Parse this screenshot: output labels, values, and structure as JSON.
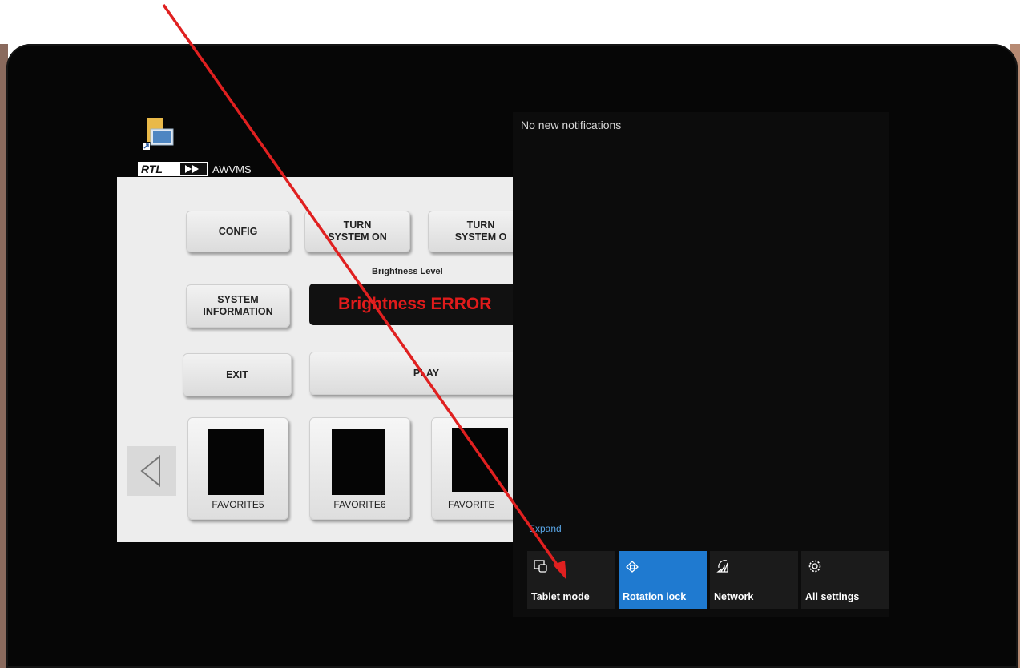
{
  "desktop": {
    "shortcut_label": "AWVMS",
    "logo_text": "RTL"
  },
  "app": {
    "buttons": {
      "config": "CONFIG",
      "turn_on": "TURN\nSYSTEM ON",
      "turn_off": "TURN\nSYSTEM O",
      "system_info": "SYSTEM\nINFORMATION",
      "exit": "EXIT",
      "play": "PLAY"
    },
    "brightness": {
      "title": "Brightness Level",
      "value": "Brightness ERROR",
      "value_color": "#e01b1b"
    },
    "favorites": [
      "FAVORITE5",
      "FAVORITE6",
      "FAVORITE"
    ],
    "prev_icon": "triangle-left-icon"
  },
  "action_center": {
    "notifications_text": "No new notifications",
    "expand_label": "Expand",
    "quick_actions": [
      {
        "label": "Tablet mode",
        "icon": "tablet-mode-icon",
        "active": false
      },
      {
        "label": "Rotation lock",
        "icon": "rotation-lock-icon",
        "active": true
      },
      {
        "label": "Network",
        "icon": "network-icon",
        "active": false
      },
      {
        "label": "All settings",
        "icon": "gear-icon",
        "active": false
      }
    ],
    "accent_color": "#1f7ad0"
  },
  "annotation": {
    "arrow_color": "#e02020"
  }
}
